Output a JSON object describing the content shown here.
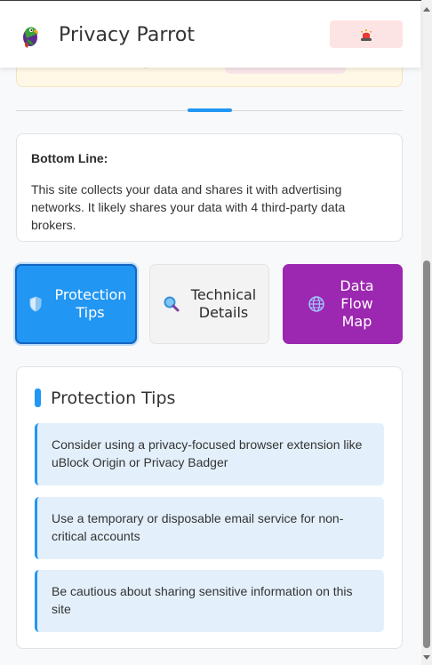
{
  "header": {
    "title": "Privacy Parrot",
    "logo_icon": "parrot-icon",
    "alert_icon": "siren-icon",
    "alert_color": "#fde4e4"
  },
  "bottom_line": {
    "title": "Bottom Line:",
    "text": "This site collects your data and shares it with advertising networks. It likely shares your data with 4 third-party data brokers."
  },
  "actions": [
    {
      "label": "Protection Tips",
      "icon": "shield-icon",
      "color": "#2196f3",
      "active": true
    },
    {
      "label": "Technical Details",
      "icon": "magnifier-icon",
      "color": "#f3f3f3",
      "active": false
    },
    {
      "label": "Data Flow Map",
      "icon": "globe-icon",
      "color": "#9c27b0",
      "active": false
    }
  ],
  "tips_panel": {
    "title": "Protection Tips",
    "tips": [
      "Consider using a privacy-focused browser extension like uBlock Origin or Privacy Badger",
      "Use a temporary or disposable email service for non-critical accounts",
      "Be cautious about sharing sensitive information on this site"
    ]
  },
  "colors": {
    "accent": "#2196f3",
    "purple": "#9c27b0",
    "tip_bg": "#e3f0fb"
  }
}
